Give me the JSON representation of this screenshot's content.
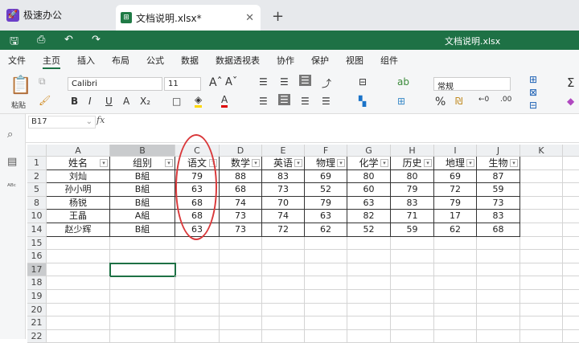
{
  "tabs": {
    "app": "极速办公",
    "doc": "文档说明.xlsx*"
  },
  "title": "文档说明.xlsx",
  "menu": [
    "文件",
    "主页",
    "插入",
    "布局",
    "公式",
    "数据",
    "数据透视表",
    "协作",
    "保护",
    "视图",
    "组件"
  ],
  "active_menu": "主页",
  "ribbon": {
    "paste": "粘贴",
    "font": "Calibri",
    "size": "11",
    "number_format": "常规"
  },
  "namebox": "B17",
  "fx": "fx",
  "columns": [
    "A",
    "B",
    "C",
    "D",
    "E",
    "F",
    "G",
    "H",
    "I",
    "J",
    "K"
  ],
  "rows": [
    "1",
    "2",
    "5",
    "8",
    "10",
    "14",
    "15",
    "16",
    "17",
    "18",
    "19",
    "20",
    "21",
    "22"
  ],
  "headers": [
    "姓名",
    "组别",
    "语文",
    "数学",
    "英语",
    "物理",
    "化学",
    "历史",
    "地理",
    "生物"
  ],
  "data": [
    [
      "刘灿",
      "B組",
      "79",
      "88",
      "83",
      "69",
      "80",
      "80",
      "69",
      "87"
    ],
    [
      "孙小明",
      "B組",
      "63",
      "68",
      "73",
      "52",
      "60",
      "79",
      "72",
      "59"
    ],
    [
      "杨锐",
      "B組",
      "68",
      "74",
      "70",
      "79",
      "63",
      "83",
      "79",
      "73"
    ],
    [
      "王晶",
      "A組",
      "68",
      "73",
      "74",
      "63",
      "82",
      "71",
      "17",
      "83"
    ],
    [
      "赵少辉",
      "B組",
      "63",
      "73",
      "72",
      "62",
      "52",
      "59",
      "62",
      "68"
    ]
  ],
  "selected_cell": "B17",
  "filtered_column": "C",
  "colors": {
    "brand": "#1e7145",
    "annotation": "#d9383a"
  }
}
